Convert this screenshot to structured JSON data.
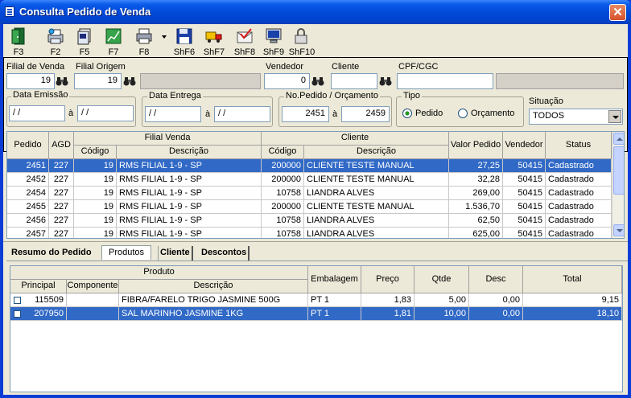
{
  "window": {
    "title": "Consulta Pedido de Venda",
    "close_glyph": "✕"
  },
  "toolbar": [
    {
      "label": "F3",
      "icon": "exit-door-icon"
    },
    {
      "label": "F2",
      "icon": "refresh-print-icon"
    },
    {
      "label": "F5",
      "icon": "copy-icon"
    },
    {
      "label": "F7",
      "icon": "chart-icon"
    },
    {
      "label": "F8",
      "icon": "printer-icon"
    },
    {
      "label": "ShF6",
      "icon": "floppy-disk-icon"
    },
    {
      "label": "ShF7",
      "icon": "truck-icon"
    },
    {
      "label": "ShF8",
      "icon": "envelope-check-icon"
    },
    {
      "label": "ShF9",
      "icon": "monitor-icon"
    },
    {
      "label": "ShF10",
      "icon": "padlock-icon"
    }
  ],
  "filters": {
    "filial_venda": {
      "label": "Filial de Venda",
      "value": "19"
    },
    "filial_origem": {
      "label": "Filial Origem",
      "value": "19",
      "desc": ""
    },
    "vendedor": {
      "label": "Vendedor",
      "value": "0"
    },
    "cliente": {
      "label": "Cliente",
      "value": ""
    },
    "cpf": {
      "label": "CPF/CGC",
      "value": "",
      "desc": ""
    },
    "data_emissao": {
      "label": "Data Emissão",
      "from": "/ /",
      "to": "/ /",
      "sep": "à"
    },
    "data_entrega": {
      "label": "Data Entrega",
      "from": "/ /",
      "to": "/ /",
      "sep": "à"
    },
    "numero": {
      "label": "No.Pedido / Orçamento",
      "from": "2451",
      "to": "2459",
      "sep": "à"
    },
    "tipo": {
      "label": "Tipo",
      "options": [
        "Pedido",
        "Orçamento"
      ],
      "selected": "Pedido"
    },
    "situacao": {
      "label": "Situação",
      "value": "TODOS"
    }
  },
  "orders": {
    "group_headers": {
      "filial_venda": "Filial Venda",
      "cliente": "Cliente"
    },
    "headers": {
      "pedido": "Pedido",
      "agd": "AGD",
      "codigo": "Código",
      "descricao": "Descrição",
      "cli_codigo": "Código",
      "cli_descricao": "Descrição",
      "valor": "Valor Pedido",
      "vendedor": "Vendedor",
      "status": "Status"
    },
    "rows": [
      {
        "pedido": "2451",
        "agd": "227",
        "filial_cod": "19",
        "filial_desc": "RMS FILIAL 1-9 - SP",
        "cli_cod": "200000",
        "cli_desc": "CLIENTE TESTE MANUAL",
        "valor": "27,25",
        "vendedor": "50415",
        "status": "Cadastrado"
      },
      {
        "pedido": "2452",
        "agd": "227",
        "filial_cod": "19",
        "filial_desc": "RMS FILIAL 1-9 - SP",
        "cli_cod": "200000",
        "cli_desc": "CLIENTE TESTE MANUAL",
        "valor": "32,28",
        "vendedor": "50415",
        "status": "Cadastrado"
      },
      {
        "pedido": "2454",
        "agd": "227",
        "filial_cod": "19",
        "filial_desc": "RMS FILIAL 1-9 - SP",
        "cli_cod": "10758",
        "cli_desc": "LIANDRA ALVES",
        "valor": "269,00",
        "vendedor": "50415",
        "status": "Cadastrado"
      },
      {
        "pedido": "2455",
        "agd": "227",
        "filial_cod": "19",
        "filial_desc": "RMS FILIAL 1-9 - SP",
        "cli_cod": "200000",
        "cli_desc": "CLIENTE TESTE MANUAL",
        "valor": "1.536,70",
        "vendedor": "50415",
        "status": "Cadastrado"
      },
      {
        "pedido": "2456",
        "agd": "227",
        "filial_cod": "19",
        "filial_desc": "RMS FILIAL 1-9 - SP",
        "cli_cod": "10758",
        "cli_desc": "LIANDRA ALVES",
        "valor": "62,50",
        "vendedor": "50415",
        "status": "Cadastrado"
      },
      {
        "pedido": "2457",
        "agd": "227",
        "filial_cod": "19",
        "filial_desc": "RMS FILIAL 1-9 - SP",
        "cli_cod": "10758",
        "cli_desc": "LIANDRA ALVES",
        "valor": "625,00",
        "vendedor": "50415",
        "status": "Cadastrado"
      }
    ]
  },
  "tabs": [
    "Resumo do Pedido",
    "Produtos",
    "Cliente",
    "Descontos"
  ],
  "active_tab": "Produtos",
  "products": {
    "group_header": "Produto",
    "headers": {
      "principal": "Principal",
      "componente": "Componente",
      "descricao": "Descrição",
      "embalagem": "Embalagem",
      "preco": "Preço",
      "qtde": "Qtde",
      "desc": "Desc",
      "total": "Total"
    },
    "rows": [
      {
        "principal": "115509",
        "componente": "",
        "descricao": "FIBRA/FARELO TRIGO JASMINE 500G",
        "embalagem": "PT 1",
        "preco": "1,83",
        "qtde": "5,00",
        "desc": "0,00",
        "total": "9,15"
      },
      {
        "principal": "207950",
        "componente": "",
        "descricao": "SAL MARINHO JASMINE 1KG",
        "embalagem": "PT 1",
        "preco": "1,81",
        "qtde": "10,00",
        "desc": "0,00",
        "total": "18,10"
      }
    ]
  }
}
